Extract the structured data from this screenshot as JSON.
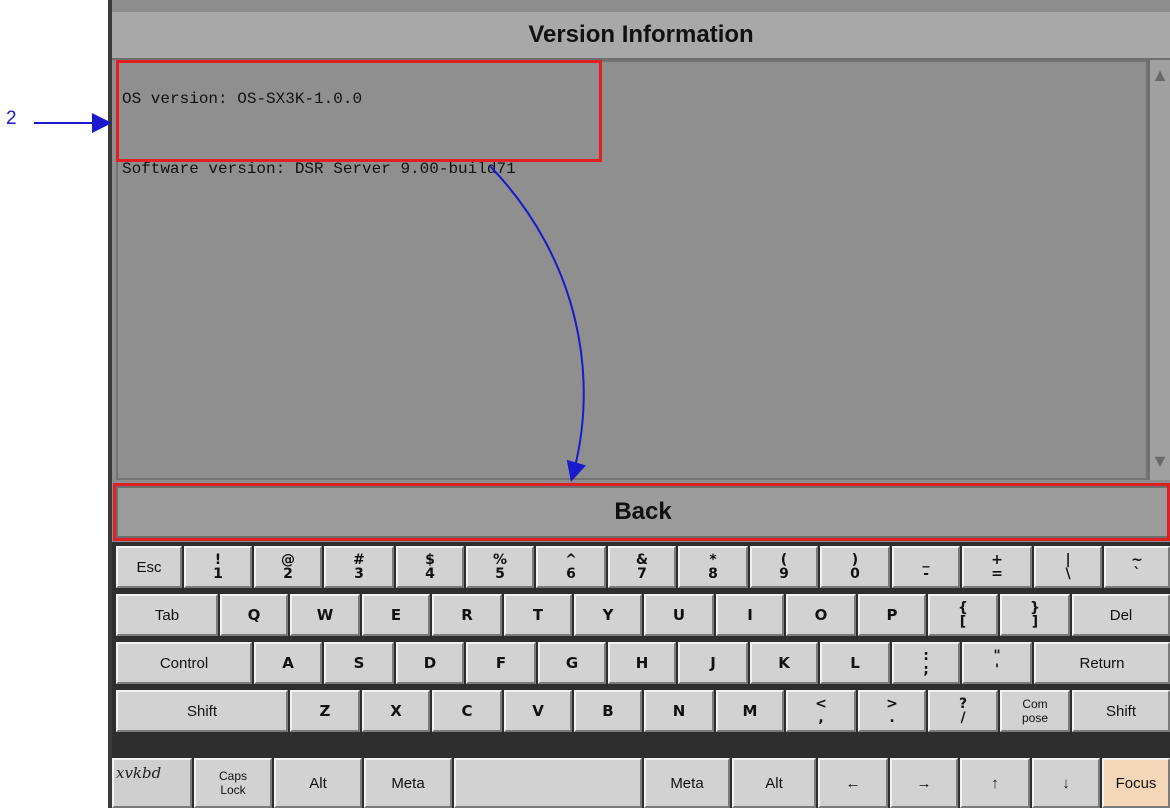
{
  "callout": {
    "number": "2"
  },
  "window": {
    "title": "Version Information"
  },
  "info": {
    "os_line": "OS version: OS-SX3K-1.0.0",
    "software_line": "Software version: DSR Server 9.00-build71"
  },
  "back_label": "Back",
  "keyboard": {
    "app_label": "xvkbd",
    "row1": [
      {
        "name": "key-esc",
        "label": "Esc"
      },
      {
        "name": "key-1",
        "top": "!",
        "bottom": "1"
      },
      {
        "name": "key-2",
        "top": "@",
        "bottom": "2"
      },
      {
        "name": "key-3",
        "top": "#",
        "bottom": "3"
      },
      {
        "name": "key-4",
        "top": "$",
        "bottom": "4"
      },
      {
        "name": "key-5",
        "top": "%",
        "bottom": "5"
      },
      {
        "name": "key-6",
        "top": "^",
        "bottom": "6"
      },
      {
        "name": "key-7",
        "top": "&",
        "bottom": "7"
      },
      {
        "name": "key-8",
        "top": "*",
        "bottom": "8"
      },
      {
        "name": "key-9",
        "top": "(",
        "bottom": "9"
      },
      {
        "name": "key-0",
        "top": ")",
        "bottom": "0"
      },
      {
        "name": "key-minus",
        "top": "_",
        "bottom": "-"
      },
      {
        "name": "key-equals",
        "top": "+",
        "bottom": "="
      },
      {
        "name": "key-backslash",
        "top": "|",
        "bottom": "\\"
      },
      {
        "name": "key-grave",
        "top": "~",
        "bottom": "`"
      }
    ],
    "row2": [
      {
        "name": "key-tab",
        "label": "Tab"
      },
      {
        "name": "key-q",
        "label": "Q"
      },
      {
        "name": "key-w",
        "label": "W"
      },
      {
        "name": "key-e",
        "label": "E"
      },
      {
        "name": "key-r",
        "label": "R"
      },
      {
        "name": "key-t",
        "label": "T"
      },
      {
        "name": "key-y",
        "label": "Y"
      },
      {
        "name": "key-u",
        "label": "U"
      },
      {
        "name": "key-i",
        "label": "I"
      },
      {
        "name": "key-o",
        "label": "O"
      },
      {
        "name": "key-p",
        "label": "P"
      },
      {
        "name": "key-lbracket",
        "top": "{",
        "bottom": "["
      },
      {
        "name": "key-rbracket",
        "top": "}",
        "bottom": "]"
      },
      {
        "name": "key-del",
        "label": "Del"
      }
    ],
    "row3": [
      {
        "name": "key-control",
        "label": "Control"
      },
      {
        "name": "key-a",
        "label": "A"
      },
      {
        "name": "key-s",
        "label": "S"
      },
      {
        "name": "key-d",
        "label": "D"
      },
      {
        "name": "key-f",
        "label": "F"
      },
      {
        "name": "key-g",
        "label": "G"
      },
      {
        "name": "key-h",
        "label": "H"
      },
      {
        "name": "key-j",
        "label": "J"
      },
      {
        "name": "key-k",
        "label": "K"
      },
      {
        "name": "key-l",
        "label": "L"
      },
      {
        "name": "key-semicolon",
        "top": ":",
        "bottom": ";"
      },
      {
        "name": "key-quote",
        "top": "\"",
        "bottom": "'"
      },
      {
        "name": "key-return",
        "label": "Return"
      }
    ],
    "row4": [
      {
        "name": "key-shift-left",
        "label": "Shift"
      },
      {
        "name": "key-z",
        "label": "Z"
      },
      {
        "name": "key-x",
        "label": "X"
      },
      {
        "name": "key-c",
        "label": "C"
      },
      {
        "name": "key-v",
        "label": "V"
      },
      {
        "name": "key-b",
        "label": "B"
      },
      {
        "name": "key-n",
        "label": "N"
      },
      {
        "name": "key-m",
        "label": "M"
      },
      {
        "name": "key-comma",
        "top": "<",
        "bottom": ","
      },
      {
        "name": "key-period",
        "top": ">",
        "bottom": "."
      },
      {
        "name": "key-slash",
        "top": "?",
        "bottom": "/"
      },
      {
        "name": "key-compose",
        "top": "Com",
        "bottom": "pose"
      },
      {
        "name": "key-shift-right",
        "label": "Shift"
      }
    ],
    "row5": [
      {
        "name": "key-caps-lock",
        "top": "Caps",
        "bottom": "Lock"
      },
      {
        "name": "key-alt-left",
        "label": "Alt"
      },
      {
        "name": "key-meta-left",
        "label": "Meta"
      },
      {
        "name": "key-space",
        "label": ""
      },
      {
        "name": "key-meta-right",
        "label": "Meta"
      },
      {
        "name": "key-alt-right",
        "label": "Alt"
      },
      {
        "name": "key-left-arrow",
        "label": "←"
      },
      {
        "name": "key-right-arrow",
        "label": "→"
      },
      {
        "name": "key-up-arrow",
        "label": "↑"
      },
      {
        "name": "key-down-arrow",
        "label": "↓"
      },
      {
        "name": "key-focus",
        "label": "Focus"
      }
    ]
  }
}
